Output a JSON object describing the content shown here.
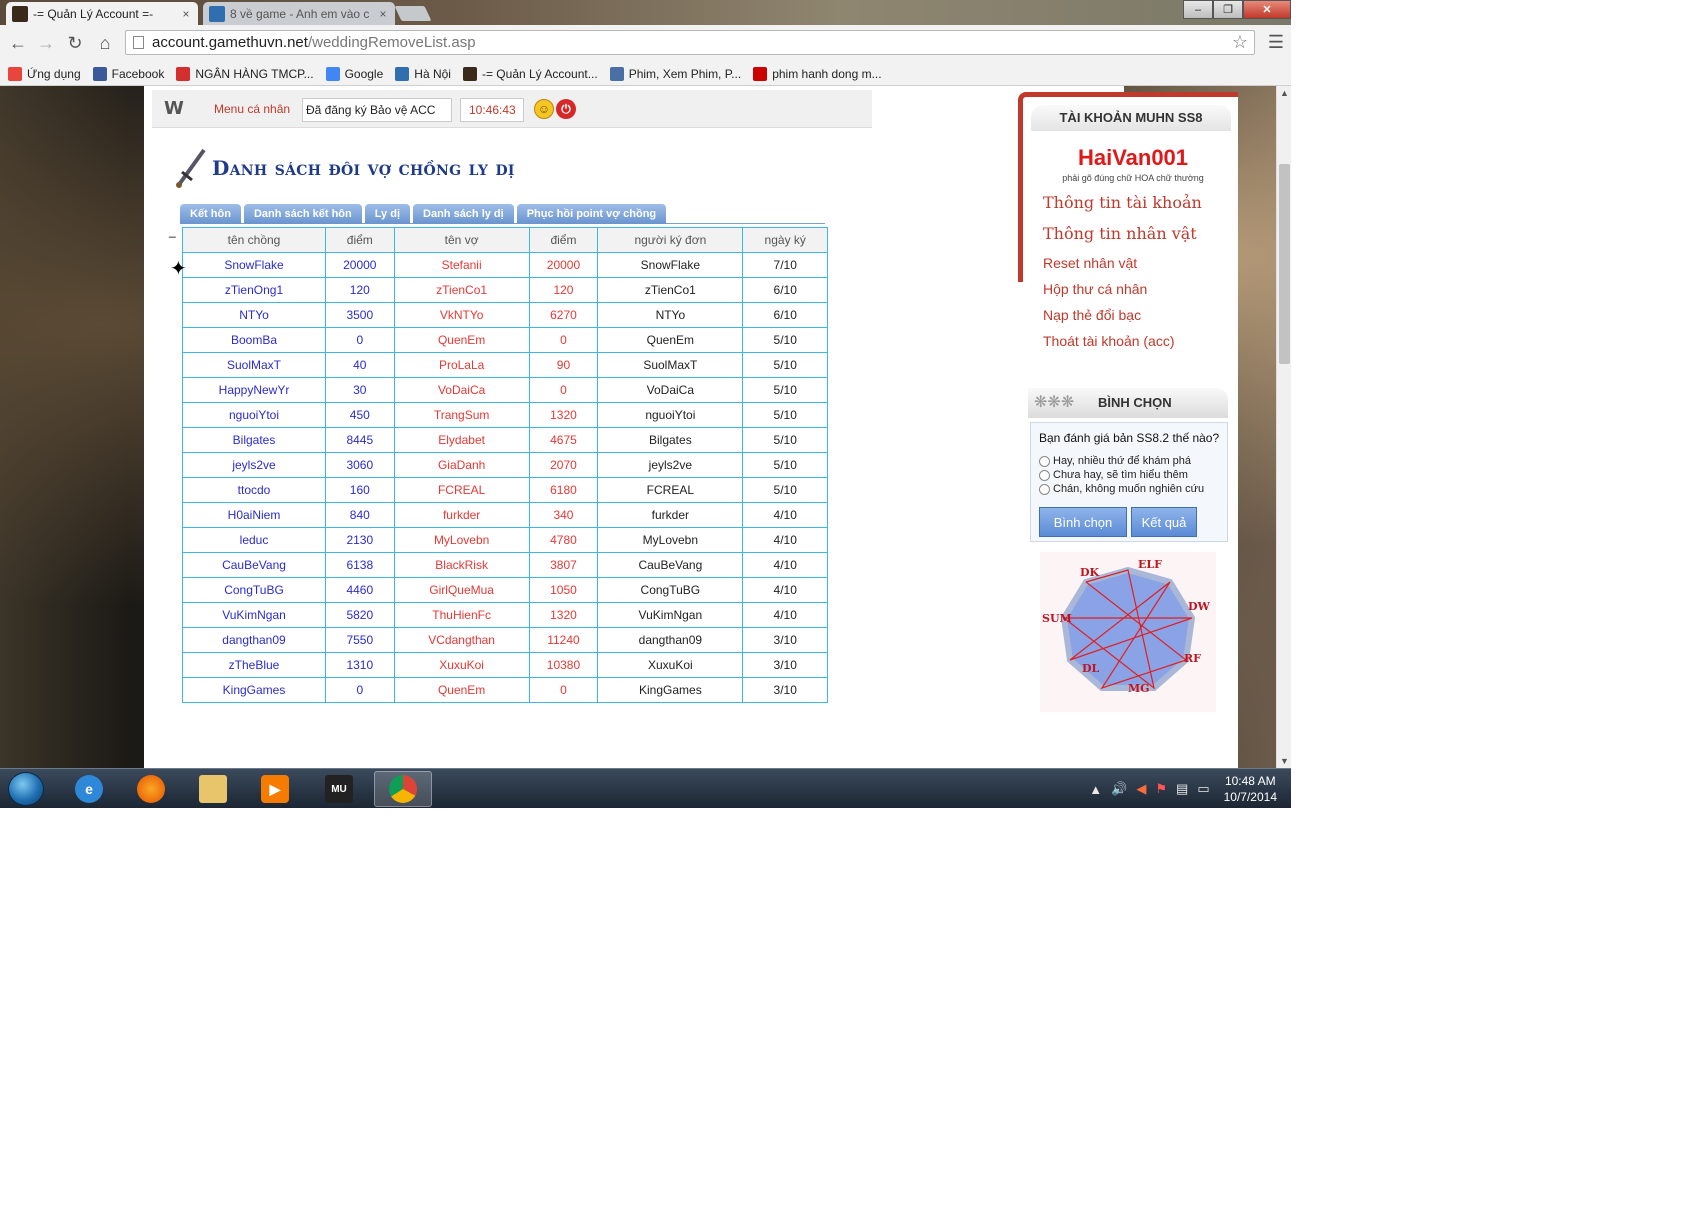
{
  "browser": {
    "tabs": [
      {
        "label": "-= Quản Lý Account =-",
        "close": "×",
        "favicon_color": "#3a2a1a"
      },
      {
        "label": "8 về game - Anh em vào c",
        "close": "×",
        "favicon_color": "#2f6fb0"
      }
    ],
    "window_buttons": {
      "minimize": "–",
      "maximize": "❐",
      "close": "✕"
    },
    "url_host": "account.gamethuvn.net",
    "url_path": "/weddingRemoveList.asp",
    "bookmarks": [
      {
        "label": "Ứng dụng",
        "icon": "apps-grid-icon",
        "color": "#e8453c"
      },
      {
        "label": "Facebook",
        "icon": "facebook-icon",
        "color": "#3b5998"
      },
      {
        "label": "NGÂN HÀNG TMCP...",
        "icon": "techcombank-icon",
        "color": "#d32f2f"
      },
      {
        "label": "Google",
        "icon": "google-icon",
        "color": "#4285f4"
      },
      {
        "label": "Hà Nội",
        "icon": "globe-icon",
        "color": "#2f6fb0"
      },
      {
        "label": "-= Quản Lý Account...",
        "icon": "game-icon",
        "color": "#3a2a1a"
      },
      {
        "label": "Phim, Xem Phim, P...",
        "icon": "movie-icon",
        "color": "#4a6fa5"
      },
      {
        "label": "phim hanh dong m...",
        "icon": "youtube-icon",
        "color": "#cc0000"
      }
    ]
  },
  "header": {
    "logo": "W",
    "menu_label": "Menu cá nhân",
    "status_text": "Đã đăng ký Bảo vệ ACC",
    "time": "10:46:43"
  },
  "page": {
    "title": "Danh sách đôi vợ chồng ly dị",
    "subnav": [
      "Kết hôn",
      "Danh sách kết hôn",
      "Ly dị",
      "Danh sách ly dị",
      "Phục hồi point vợ chồng"
    ],
    "dash": "_"
  },
  "table": {
    "headers": [
      "tên chồng",
      "điểm",
      "tên vợ",
      "điểm",
      "người ký đơn",
      "ngày ký"
    ],
    "rows": [
      [
        "SnowFlake",
        "20000",
        "Stefanii",
        "20000",
        "SnowFlake",
        "7/10"
      ],
      [
        "zTienOng1",
        "120",
        "zTienCo1",
        "120",
        "zTienCo1",
        "6/10"
      ],
      [
        "NTYo",
        "3500",
        "VkNTYo",
        "6270",
        "NTYo",
        "6/10"
      ],
      [
        "BoomBa",
        "0",
        "QuenEm",
        "0",
        "QuenEm",
        "5/10"
      ],
      [
        "SuolMaxT",
        "40",
        "ProLaLa",
        "90",
        "SuolMaxT",
        "5/10"
      ],
      [
        "HappyNewYr",
        "30",
        "VoDaiCa",
        "0",
        "VoDaiCa",
        "5/10"
      ],
      [
        "nguoiYtoi",
        "450",
        "TrangSum",
        "1320",
        "nguoiYtoi",
        "5/10"
      ],
      [
        "Bilgates",
        "8445",
        "Elydabet",
        "4675",
        "Bilgates",
        "5/10"
      ],
      [
        "jeyls2ve",
        "3060",
        "GiaDanh",
        "2070",
        "jeyls2ve",
        "5/10"
      ],
      [
        "ttocdo",
        "160",
        "FCREAL",
        "6180",
        "FCREAL",
        "5/10"
      ],
      [
        "H0aiNiem",
        "840",
        "furkder",
        "340",
        "furkder",
        "4/10"
      ],
      [
        "leduc",
        "2130",
        "MyLovebn",
        "4780",
        "MyLovebn",
        "4/10"
      ],
      [
        "CauBeVang",
        "6138",
        "BlackRisk",
        "3807",
        "CauBeVang",
        "4/10"
      ],
      [
        "CongTuBG",
        "4460",
        "GirlQueMua",
        "1050",
        "CongTuBG",
        "4/10"
      ],
      [
        "VuKimNgan",
        "5820",
        "ThuHienFc",
        "1320",
        "VuKimNgan",
        "4/10"
      ],
      [
        "dangthan09",
        "7550",
        "VCdangthan",
        "11240",
        "dangthan09",
        "3/10"
      ],
      [
        "zTheBlue",
        "1310",
        "XuxuKoi",
        "10380",
        "XuxuKoi",
        "3/10"
      ],
      [
        "KingGames",
        "0",
        "QuenEm",
        "0",
        "KingGames",
        "3/10"
      ]
    ]
  },
  "sidebar": {
    "account_header": "TÀI KHOẢN MUHN SS8",
    "username": "HaiVan001",
    "hint": "phải gõ đúng chữ HOA chữ thường",
    "links": [
      {
        "label": "Thông tin tài khoản",
        "serif": true
      },
      {
        "label": "Thông tin nhân vật",
        "serif": true
      },
      {
        "label": "Reset nhân vật",
        "serif": false
      },
      {
        "label": "Hộp thư cá nhân",
        "serif": false
      },
      {
        "label": "Nạp thẻ đổi bạc",
        "serif": false
      },
      {
        "label": "Thoát tài khoản (acc)",
        "serif": false
      }
    ],
    "poll": {
      "title": "BÌNH CHỌN",
      "question": "Bạn đánh giá bản SS8.2 thế nào?",
      "options": [
        "Hay, nhiều thứ để khám phá",
        "Chưa hay, sẽ tìm hiểu thêm",
        "Chán, không muốn nghiên cứu"
      ],
      "vote_button": "Bình chọn",
      "result_button": "Kết quả"
    },
    "class_labels": [
      "DK",
      "ELF",
      "DW",
      "RF",
      "MG",
      "DL",
      "SUM"
    ]
  },
  "taskbar": {
    "apps": [
      "internet-explorer-icon",
      "firefox-icon",
      "file-explorer-icon",
      "media-player-icon",
      "mu-game-icon",
      "chrome-icon"
    ],
    "time": "10:48 AM",
    "date": "10/7/2014"
  },
  "colors": {
    "link_red": "#c0392b",
    "husband_blue": "#2b2bd0",
    "wife_red": "#e53935",
    "table_border": "#3cb8e8",
    "title_blue": "#1e3a8a"
  }
}
